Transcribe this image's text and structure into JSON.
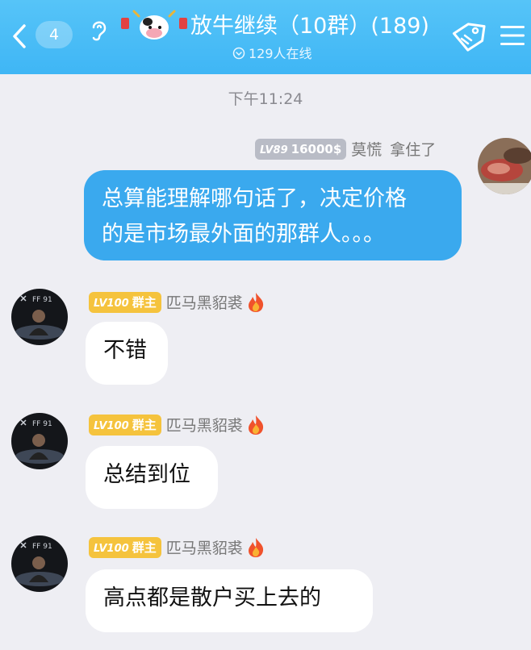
{
  "header": {
    "unread_count": "4",
    "title": "放牛继续（10群）(189)",
    "online_text": "129人在线",
    "bg_color": "#3fb6f5"
  },
  "chat": {
    "timestamp": "下午11:24",
    "messages": [
      {
        "side": "right",
        "level": "LV89",
        "title": "16000$",
        "name": "莫慌",
        "extra": "拿住了",
        "text_line1": "总算能理解哪句话了，决定价格",
        "text_line2": "的是市场最外面的那群人。。。"
      },
      {
        "side": "left",
        "level": "LV100",
        "title": "群主",
        "name": "匹马黑貂裘",
        "text": "不错"
      },
      {
        "side": "left",
        "level": "LV100",
        "title": "群主",
        "name": "匹马黑貂裘",
        "text": "总结到位"
      },
      {
        "side": "left",
        "level": "LV100",
        "title": "群主",
        "name": "匹马黑貂裘",
        "text": "高点都是散户买上去的"
      }
    ]
  },
  "icons": {
    "back": "chevron-left-icon",
    "ear": "ear-icon",
    "online": "chevron-circle-icon",
    "tag": "tag-icon",
    "menu": "menu-icon",
    "fire": "fire-icon"
  }
}
